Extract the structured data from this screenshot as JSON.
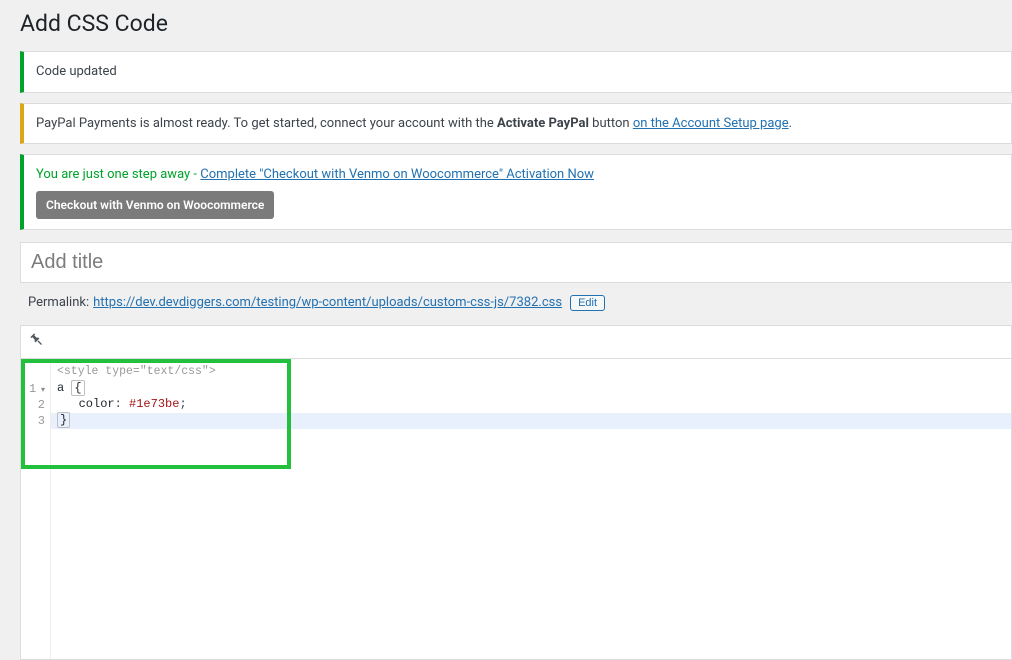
{
  "page": {
    "title": "Add CSS Code"
  },
  "notices": {
    "updated": "Code updated",
    "paypal_prefix": "PayPal Payments is almost ready. To get started, connect your account with the ",
    "paypal_bold": "Activate PayPal",
    "paypal_mid": " button ",
    "paypal_link": "on the Account Setup page",
    "paypal_suffix": ".",
    "venmo_prefix": "You are just one step away - ",
    "venmo_link": "Complete \"Checkout with Venmo on Woocommerce\" Activation Now",
    "venmo_badge": "Checkout with Venmo on Woocommerce"
  },
  "title_field": {
    "placeholder": "Add title",
    "value": ""
  },
  "permalink": {
    "label": "Permalink:",
    "url": "https://dev.devdiggers.com/testing/wp-content/uploads/custom-css-js/7382.css",
    "edit_label": "Edit"
  },
  "editor": {
    "header": "<style type=\"text/css\">",
    "lines": [
      {
        "n": "1",
        "fold": true,
        "html": "<span class='tok-tag'>a</span> <span class='tok-brace'>{</span>"
      },
      {
        "n": "2",
        "fold": false,
        "html": "   <span class='tok-prop'>color</span>: <span class='tok-val'>#1e73be</span>;"
      },
      {
        "n": "3",
        "fold": false,
        "html": "<span class='tok-brace'>}</span>",
        "active": true
      }
    ]
  }
}
